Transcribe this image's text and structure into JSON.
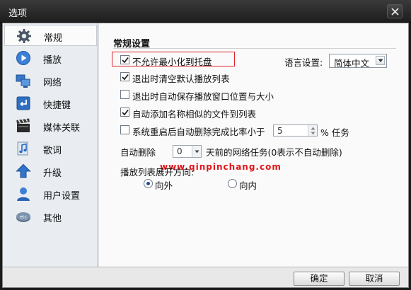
{
  "window": {
    "title": "选项"
  },
  "sidebar": {
    "items": [
      {
        "label": "常规",
        "icon": "gear-icon",
        "active": true
      },
      {
        "label": "播放",
        "icon": "play-icon"
      },
      {
        "label": "网络",
        "icon": "network-icon"
      },
      {
        "label": "快捷键",
        "icon": "shortcut-icon"
      },
      {
        "label": "媒体关联",
        "icon": "clapper-icon"
      },
      {
        "label": "歌词",
        "icon": "music-note-icon"
      },
      {
        "label": "升级",
        "icon": "upgrade-arrow-icon"
      },
      {
        "label": "用户设置",
        "icon": "user-icon"
      },
      {
        "label": "其他",
        "icon": "etc-icon"
      }
    ]
  },
  "general": {
    "section_title": "常规设置",
    "options": [
      {
        "label": "不允许最小化到托盘",
        "checked": true
      },
      {
        "label": "退出时清空默认播放列表",
        "checked": true
      },
      {
        "label": "退出时自动保存播放窗口位置与大小",
        "checked": false
      },
      {
        "label": "自动添加名称相似的文件到列表",
        "checked": true
      },
      {
        "label": "系统重启后自动删除完成比率小于",
        "checked": false
      }
    ],
    "language_label": "语言设置:",
    "language_value": "简体中文",
    "ratio_value": "5",
    "ratio_suffix": "% 任务",
    "auto_delete_prefix": "自动删除",
    "auto_delete_days": "0",
    "auto_delete_suffix": "天前的网络任务(0表示不自动删除)",
    "watermark": "www.qinpinchang.com",
    "playlist_direction_label": "播放列表展开方向:",
    "direction_options": [
      {
        "label": "向外",
        "selected": true
      },
      {
        "label": "向内",
        "selected": false
      }
    ]
  },
  "footer": {
    "ok_label": "确定",
    "cancel_label": "取消"
  },
  "colors": {
    "highlight": "#d9262c",
    "accent": "#1e4f98"
  }
}
